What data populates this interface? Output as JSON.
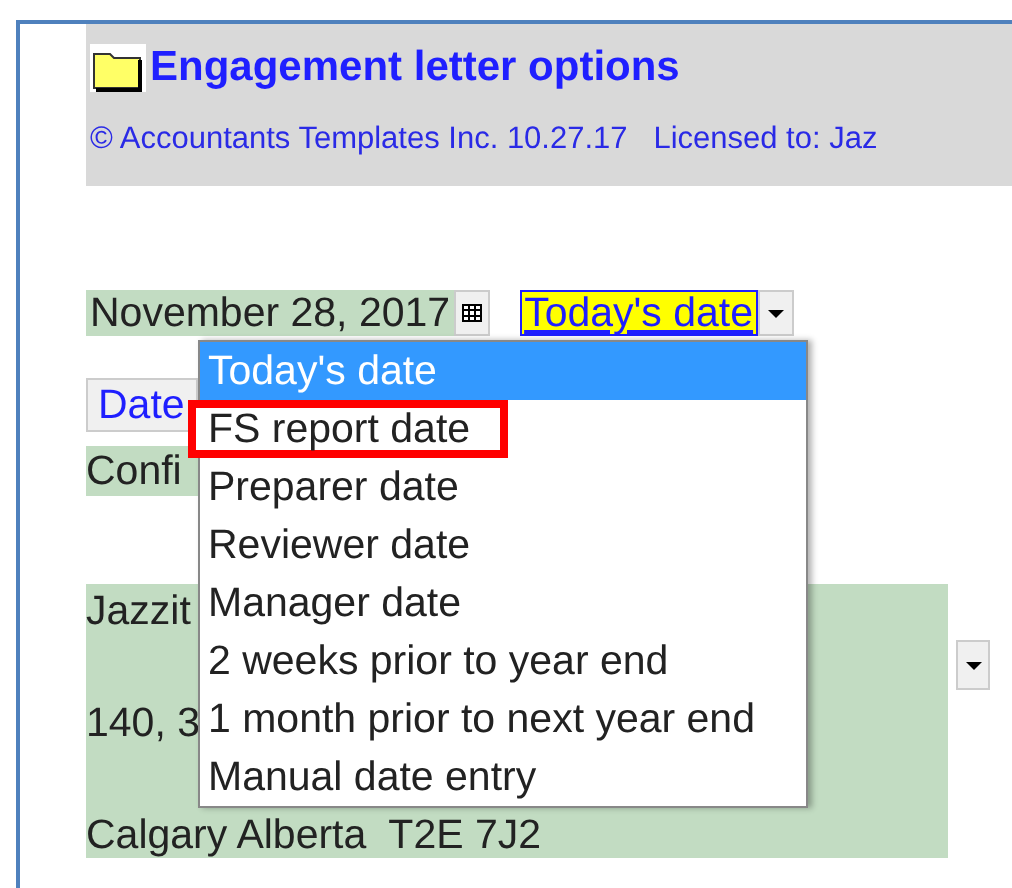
{
  "header": {
    "title": "Engagement letter options",
    "copyright": "© Accountants Templates Inc. 10.27.17   Licensed to: Jaz"
  },
  "date_row": {
    "date": "November 28, 2017",
    "date_source": "Today's date"
  },
  "date_button": "Date",
  "confidential_label": "Confi",
  "address": {
    "lines": [
      "Jazzit",
      "140, 3",
      "Calgary Alberta  T2E 7J2"
    ]
  },
  "dropdown_list": [
    {
      "label": "Today's date",
      "selected": true,
      "highlighted": false
    },
    {
      "label": "FS report date",
      "selected": false,
      "highlighted": true
    },
    {
      "label": "Preparer date",
      "selected": false,
      "highlighted": false
    },
    {
      "label": "Reviewer date",
      "selected": false,
      "highlighted": false
    },
    {
      "label": "Manager date",
      "selected": false,
      "highlighted": false
    },
    {
      "label": "2 weeks prior to year end",
      "selected": false,
      "highlighted": false
    },
    {
      "label": "1 month prior to next year end",
      "selected": false,
      "highlighted": false
    },
    {
      "label": "Manual date entry",
      "selected": false,
      "highlighted": false
    }
  ]
}
